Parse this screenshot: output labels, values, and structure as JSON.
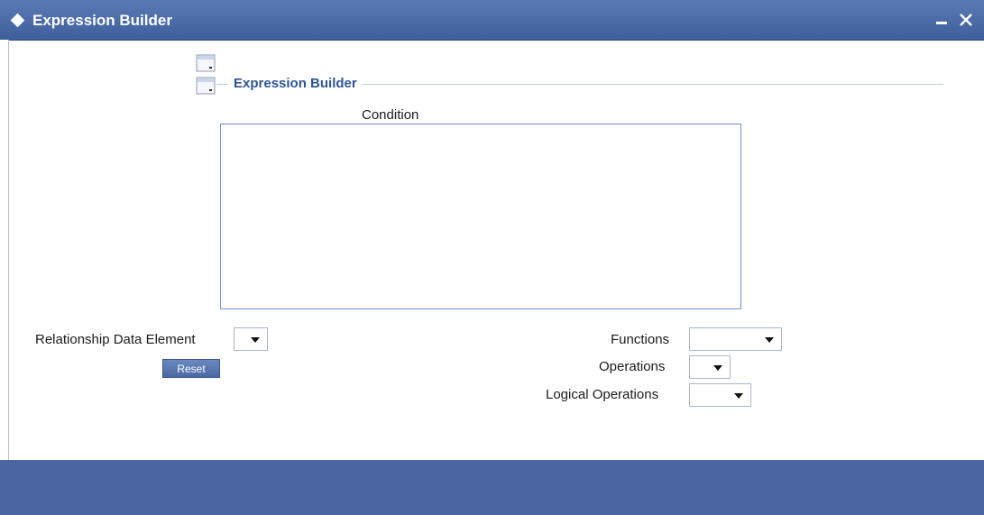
{
  "window": {
    "title": "Expression Builder",
    "icons": {
      "title": "diamond-icon",
      "minimize": "minimize-icon",
      "close": "close-icon"
    }
  },
  "toolbar": {
    "icons": [
      "document-icon",
      "document-icon"
    ]
  },
  "section": {
    "title": "Expression Builder"
  },
  "condition": {
    "label": "Condition",
    "value": ""
  },
  "relationship": {
    "label": "Relationship Data Element",
    "selected": ""
  },
  "reset_label": "Reset",
  "functions": {
    "label": "Functions",
    "selected": ""
  },
  "operations": {
    "label": "Operations",
    "selected": ""
  },
  "logical_operations": {
    "label": "Logical Operations",
    "selected": ""
  },
  "colors": {
    "titlebar": "#4a6aa8",
    "footer": "#4a65a0",
    "section_title": "#2e5595",
    "border": "#6f8fc4"
  }
}
